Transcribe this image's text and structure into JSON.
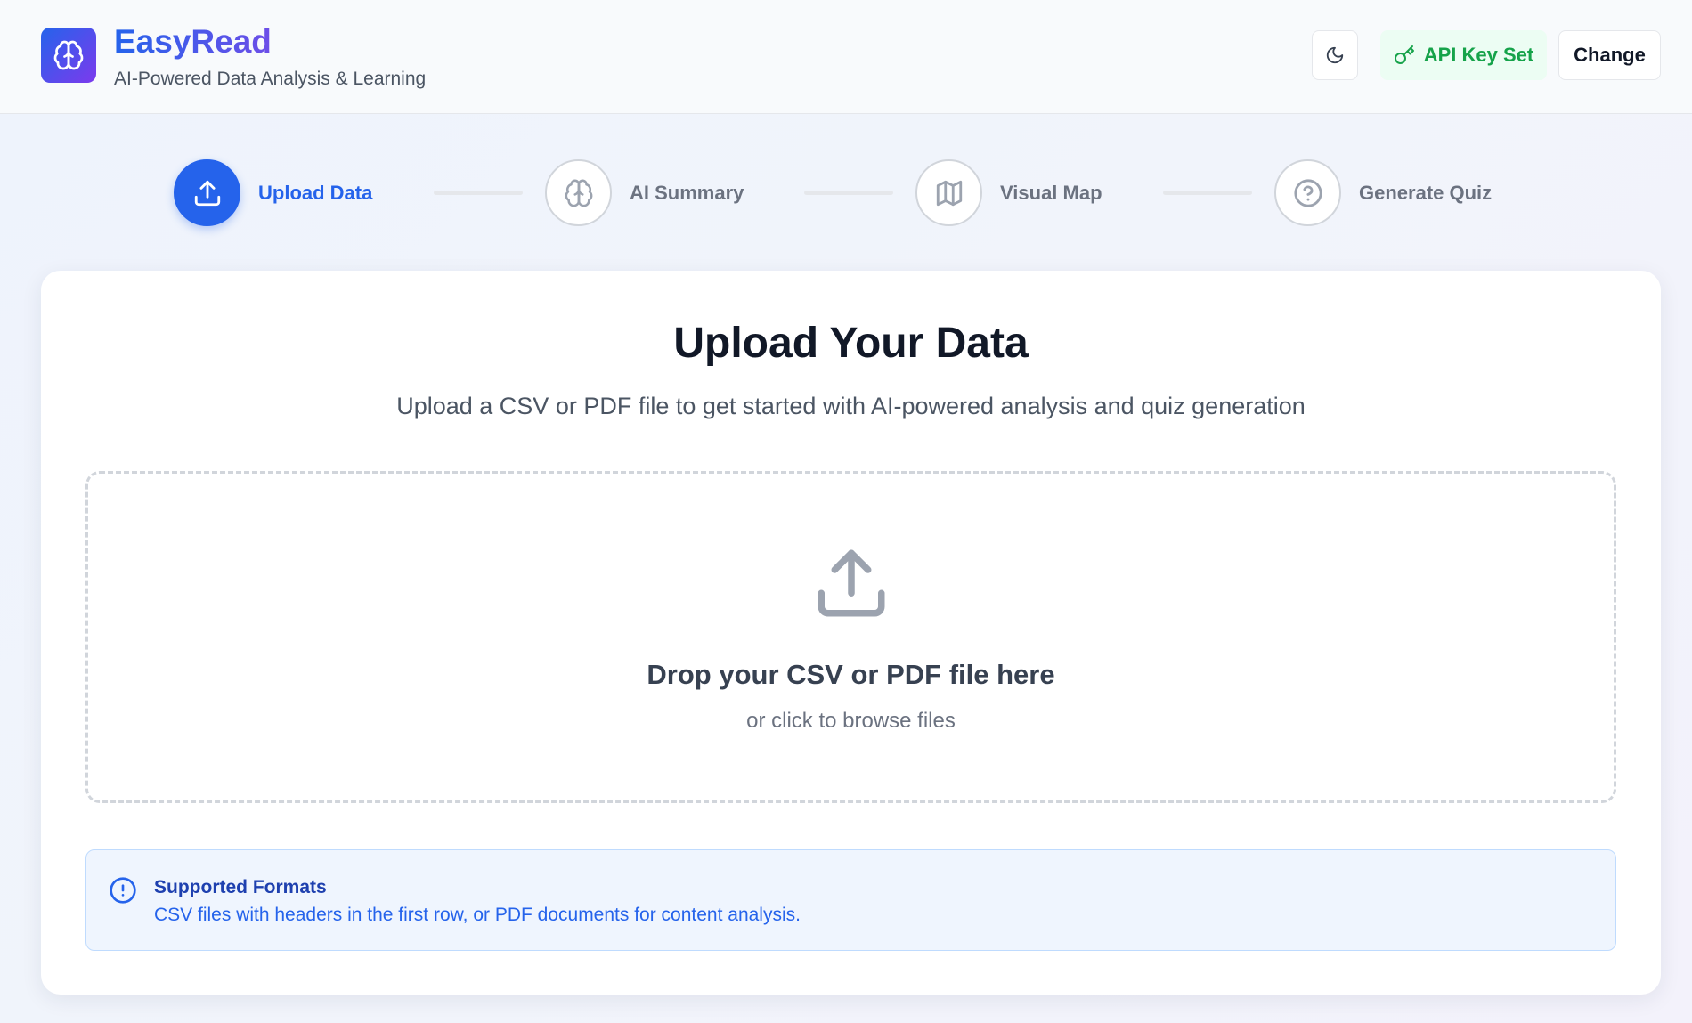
{
  "header": {
    "app_title": "EasyRead",
    "app_subtitle": "AI-Powered Data Analysis & Learning",
    "theme_toggle_icon": "moon-icon",
    "api_status_label": "API Key Set",
    "api_status_icon": "key-icon",
    "change_label": "Change"
  },
  "stepper": {
    "steps": [
      {
        "label": "Upload Data",
        "icon": "upload-icon",
        "active": true
      },
      {
        "label": "AI Summary",
        "icon": "brain-icon",
        "active": false
      },
      {
        "label": "Visual Map",
        "icon": "map-icon",
        "active": false
      },
      {
        "label": "Generate Quiz",
        "icon": "help-circle-icon",
        "active": false
      }
    ]
  },
  "main": {
    "title": "Upload Your Data",
    "subtitle": "Upload a CSV or PDF file to get started with AI-powered analysis and quiz generation",
    "dropzone": {
      "icon": "upload-icon",
      "title": "Drop your CSV or PDF file here",
      "subtitle": "or click to browse files"
    },
    "info": {
      "icon": "alert-circle-icon",
      "title": "Supported Formats",
      "text": "CSV files with headers in the first row, or PDF documents for content analysis."
    }
  },
  "colors": {
    "primary": "#2563eb",
    "brand_gradient_end": "#7c3aed",
    "success": "#16a34a",
    "success_bg": "#ecfdf3",
    "info_bg": "#eff5fe",
    "inactive": "#6b7280"
  }
}
